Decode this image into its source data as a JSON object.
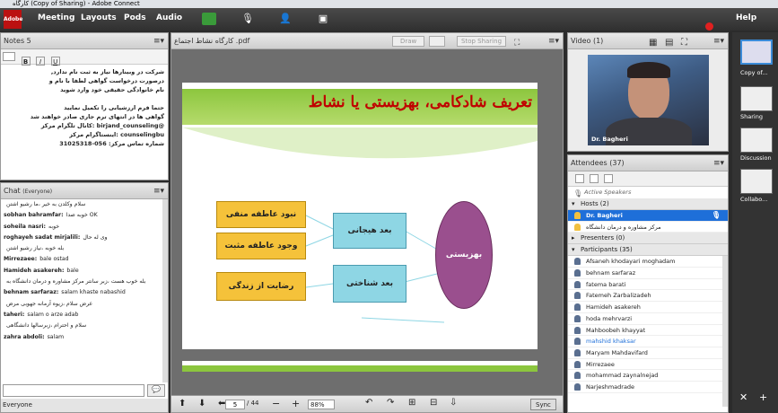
{
  "window": {
    "title": "کارگاه (Copy of Sharing) - Adobe Connect"
  },
  "menu": {
    "logo": "Adobe",
    "items": [
      "Meeting",
      "Layouts",
      "Pods",
      "Audio"
    ],
    "help": "Help"
  },
  "notes": {
    "title": "Notes 5",
    "lines": [
      "شرکت در وبینارها نیاز به ثبت نام ندارد,",
      "درصورت درخواست گواهی لطفا با نام و",
      "نام خانوادگی حقیقی خود وارد شوید",
      "",
      "حتما فرم ارزشیابی را تکمیل نمایید",
      "گواهی ها در انتهای ترم جاری صادر خواهند شد",
      "@birjand_counseling :کانال تلگرام مرکز",
      "counselingbu :اینستاگرام مرکز",
      "شماره تماس مرکز: 056-31025318"
    ]
  },
  "chat": {
    "title": "Chat",
    "scope": "(Everyone)",
    "input_target": "Everyone",
    "messages": [
      {
        "who": "",
        "text": "سلام وکلدن به خیر ،ما رشیو اشتن"
      },
      {
        "who": "sobhan bahramfar:",
        "text": "خوبه صدا OK"
      },
      {
        "who": "soheila nasri:",
        "text": "خوبه"
      },
      {
        "who": "roghayeh sadat mirjalili:",
        "text": "وی له حال"
      },
      {
        "who": "",
        "text": "بله خوبه ،نیاز رشیو اشتن"
      },
      {
        "who": "Mirrezaee:",
        "text": "bale ostad"
      },
      {
        "who": "Hamideh asakereh:",
        "text": "bale"
      },
      {
        "who": "",
        "text": "بله خوب هست ،زبر سانتر مرکز مشاوره و درمان دانشگاه به"
      },
      {
        "who": "behnam sarfaraz:",
        "text": "salam khaste nabashid"
      },
      {
        "who": "",
        "text": "عرض سلام ،زیوه آرمانه جهوبی مرض"
      },
      {
        "who": "taheri:",
        "text": "salam o arze adab"
      },
      {
        "who": "",
        "text": "سلام و احترام ،زبرسالها دانشگاهی"
      },
      {
        "who": "zahra abdoli:",
        "text": "salam"
      }
    ]
  },
  "share": {
    "filename": "کارگاه نشاط اجتماع .pdf",
    "draw": "Draw",
    "stop": "Stop Sharing",
    "page": "5",
    "total": "/ 44",
    "zoom": "88%",
    "sync": "Sync"
  },
  "slide": {
    "title": "تعریف شادکامی، بهزیستی یا نشاط",
    "left_boxes": [
      "نبود عاطفه منفی",
      "وجود عاطفه مثبت",
      "رضایت از زندگی"
    ],
    "mid_boxes": [
      "بعد هیجانی",
      "بعد شناختی"
    ],
    "oval": "بهزیستی"
  },
  "video": {
    "title": "Video",
    "count": "(1)",
    "name": "Dr. Bagheri"
  },
  "attendees": {
    "title": "Attendees",
    "count": "(37)",
    "active": "Active Speakers",
    "hosts_label": "Hosts (2)",
    "hosts": [
      "Dr. Bagheri",
      "مرکز مشاوره و درمان دانشگاه"
    ],
    "presenters_label": "Presenters (0)",
    "participants_label": "Participants (35)",
    "participants": [
      "Afsaneh khodayari moghadam",
      "behnam sarfaraz",
      "fatema barati",
      "Fatemeh Zarbalizadeh",
      "Hamideh asakereh",
      "hoda mehrvarzi",
      "Mahboobeh khayyat",
      "mahshid khaksar",
      "Maryam Mahdavifard",
      "Mirrezaee",
      "mohammad zaynalnejad",
      "Narjeshmadrade"
    ]
  },
  "sidebar": {
    "labels": [
      "Copy of...",
      "Sharing",
      "Discussion",
      "Collabo..."
    ]
  },
  "colors": {
    "accent": "#1e6fd9",
    "slide_green": "#8cc63e",
    "box_yellow": "#f5c23a",
    "box_cyan": "#8ed6e4",
    "oval": "#9a4f8e",
    "title_red": "#c00000"
  }
}
